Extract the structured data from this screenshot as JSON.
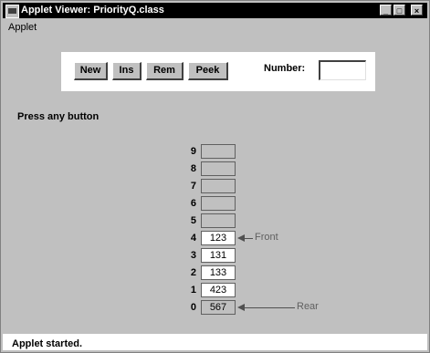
{
  "window": {
    "title": "Applet Viewer: PriorityQ.class",
    "controls": {
      "minimize": "_",
      "maximize": "□",
      "close": "×"
    }
  },
  "menu": {
    "items": [
      "Applet"
    ]
  },
  "toolbar": {
    "buttons": [
      "New",
      "Ins",
      "Rem",
      "Peek"
    ],
    "number_label": "Number:",
    "number_value": ""
  },
  "message": "Press any button",
  "queue": {
    "slots": [
      {
        "index": "9",
        "value": ""
      },
      {
        "index": "8",
        "value": ""
      },
      {
        "index": "7",
        "value": ""
      },
      {
        "index": "6",
        "value": ""
      },
      {
        "index": "5",
        "value": ""
      },
      {
        "index": "4",
        "value": "123"
      },
      {
        "index": "3",
        "value": "131"
      },
      {
        "index": "2",
        "value": "133"
      },
      {
        "index": "1",
        "value": "423"
      },
      {
        "index": "0",
        "value": "567"
      }
    ],
    "front_label": "Front",
    "rear_label": "Rear"
  },
  "status": "Applet started."
}
